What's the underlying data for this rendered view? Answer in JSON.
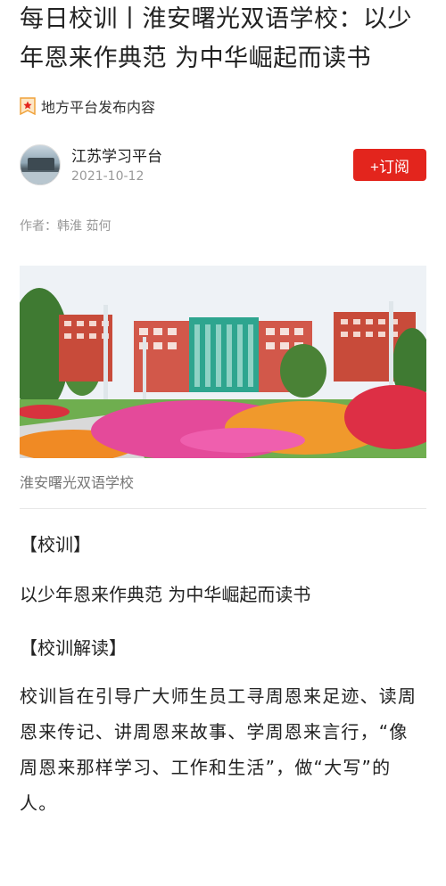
{
  "article": {
    "title": "每日校训丨淮安曙光双语学校：以少年恩来作典范 为中华崛起而读书",
    "source_tag": "地方平台发布内容",
    "publisher": {
      "name": "江苏学习平台",
      "date": "2021-10-12",
      "subscribe_label": "+订阅"
    },
    "byline": "作者：韩淮 茹何",
    "image_caption": "淮安曙光双语学校",
    "sections": [
      {
        "heading": "【校训】",
        "body": "以少年恩来作典范 为中华崛起而读书"
      },
      {
        "heading": "【校训解读】",
        "body": "校训旨在引导广大师生员工寻周恩来足迹、读周恩来传记、讲周恩来故事、学周恩来言行，“像周恩来那样学习、工作和生活”，做“大写”的人。"
      }
    ]
  },
  "colors": {
    "accent": "#e3251d",
    "badge": "#f0a23a"
  },
  "icons": {
    "source_badge": "star-badge-icon"
  }
}
